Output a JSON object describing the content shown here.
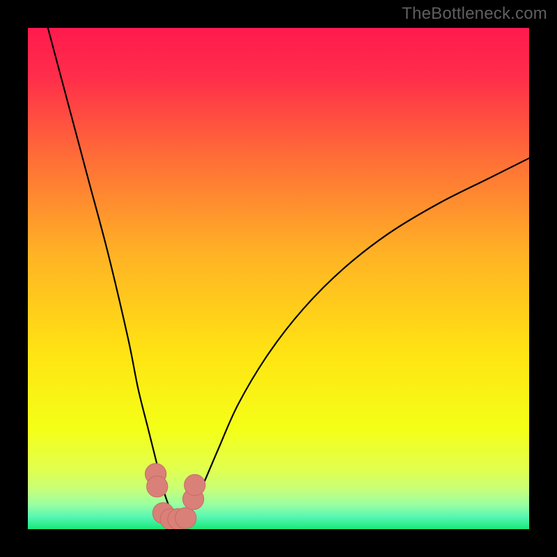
{
  "watermark": {
    "text": "TheBottleneck.com"
  },
  "colors": {
    "frame_bg": "#000000",
    "gradient_stops": [
      {
        "pos": 0.0,
        "color": "#ff1a4d"
      },
      {
        "pos": 0.1,
        "color": "#ff2e4a"
      },
      {
        "pos": 0.25,
        "color": "#ff6a38"
      },
      {
        "pos": 0.45,
        "color": "#ffb225"
      },
      {
        "pos": 0.65,
        "color": "#ffe413"
      },
      {
        "pos": 0.8,
        "color": "#f4ff17"
      },
      {
        "pos": 0.88,
        "color": "#e1ff4e"
      },
      {
        "pos": 0.92,
        "color": "#c7ff79"
      },
      {
        "pos": 0.95,
        "color": "#9bffa0"
      },
      {
        "pos": 0.975,
        "color": "#58f7b3"
      },
      {
        "pos": 1.0,
        "color": "#18e87a"
      }
    ],
    "curve": "#000000",
    "marker_fill": "#d98079",
    "marker_stroke": "#c86a63"
  },
  "chart_data": {
    "type": "line",
    "title": "",
    "xlabel": "",
    "ylabel": "",
    "xlim": [
      0,
      100
    ],
    "ylim": [
      0,
      100
    ],
    "grid": false,
    "series": [
      {
        "name": "bottleneck-curve",
        "x": [
          4,
          8,
          12,
          16,
          20,
          22,
          24,
          26,
          27,
          28,
          29,
          30,
          31,
          32,
          33,
          35,
          38,
          42,
          48,
          55,
          63,
          72,
          82,
          92,
          100
        ],
        "y": [
          100,
          85,
          70,
          55,
          38,
          28,
          20,
          12,
          8,
          5,
          3,
          2,
          2,
          3,
          5,
          9,
          16,
          25,
          35,
          44,
          52,
          59,
          65,
          70,
          74
        ]
      }
    ],
    "markers": {
      "name": "highlight-dots",
      "x": [
        25.5,
        25.8,
        27.0,
        28.5,
        30.0,
        31.5,
        33.0,
        33.3
      ],
      "y": [
        11.0,
        8.5,
        3.2,
        2.0,
        2.0,
        2.2,
        6.0,
        8.8
      ],
      "r": 2.1
    }
  }
}
